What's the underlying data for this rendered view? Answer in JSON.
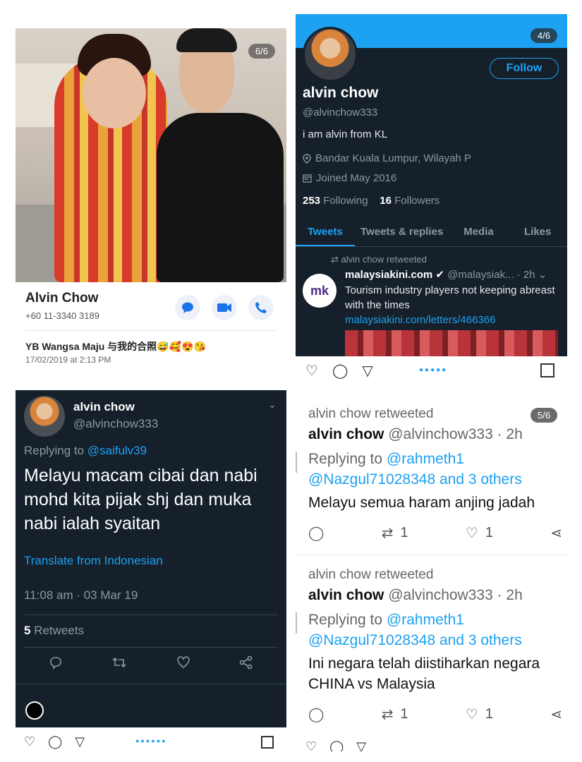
{
  "contact_card": {
    "photo_counter": "6/6",
    "name": "Alvin Chow",
    "phone": "+60 11-3340 3189",
    "caption": "YB Wangsa Maju 与我的合照😅🥰😍😘",
    "date": "17/02/2019 at 2:13 PM",
    "icons": [
      "message-icon",
      "video-call-icon",
      "phone-icon"
    ]
  },
  "profile": {
    "counter": "4/6",
    "follow_label": "Follow",
    "name": "alvin chow",
    "handle": "@alvinchow333",
    "bio": "i am alvin from KL",
    "location": "Bandar Kuala Lumpur, Wilayah P",
    "joined": "Joined May 2016",
    "following_count": "253",
    "following_label": "Following",
    "followers_count": "16",
    "followers_label": "Followers",
    "tabs": [
      {
        "label": "Tweets"
      },
      {
        "label": "Tweets & replies"
      },
      {
        "label": "Media"
      },
      {
        "label": "Likes"
      }
    ],
    "retweet_label": "alvin chow retweeted",
    "tweet": {
      "author": "malaysiakini.com",
      "handle_time": "@malaysiak... · 2h",
      "avatar_text": "mk",
      "text": "Tourism industry players not keeping abreast with the times ",
      "link": "malaysiakini.com/letters/466366"
    }
  },
  "dark_tweet": {
    "name": "alvin chow",
    "handle": "@alvinchow333",
    "replying_prefix": "Replying to ",
    "replying_to": "@saifulv39",
    "body": "Melayu macam cibai dan nabi mohd kita pijak shj dan muka nabi ialah syaitan",
    "translate": "Translate from Indonesian",
    "time": "11:08 am · 03 Mar 19",
    "retweets_count": "5",
    "retweets_label": "Retweets"
  },
  "tweets_panel": {
    "counter": "5/6",
    "tweets": [
      {
        "retweeted": "alvin chow retweeted",
        "name": "alvin chow",
        "handle_time": "@alvinchow333 · 2h",
        "replying_prefix": "Replying to ",
        "replying_line1": "@rahmeth1",
        "replying_line2": "@Nazgul71028348 and 3 others",
        "text": "Melayu semua haram anjing jadah",
        "retweets": "1",
        "likes": "1"
      },
      {
        "retweeted": "alvin chow retweeted",
        "name": "alvin chow",
        "handle_time": "@alvinchow333 · 2h",
        "replying_prefix": "Replying to ",
        "replying_line1": "@rahmeth1",
        "replying_line2": "@Nazgul71028348 and 3 others",
        "text": "Ini negara telah diistiharkan negara CHINA vs Malaysia",
        "retweets": "1",
        "likes": "1"
      }
    ]
  }
}
